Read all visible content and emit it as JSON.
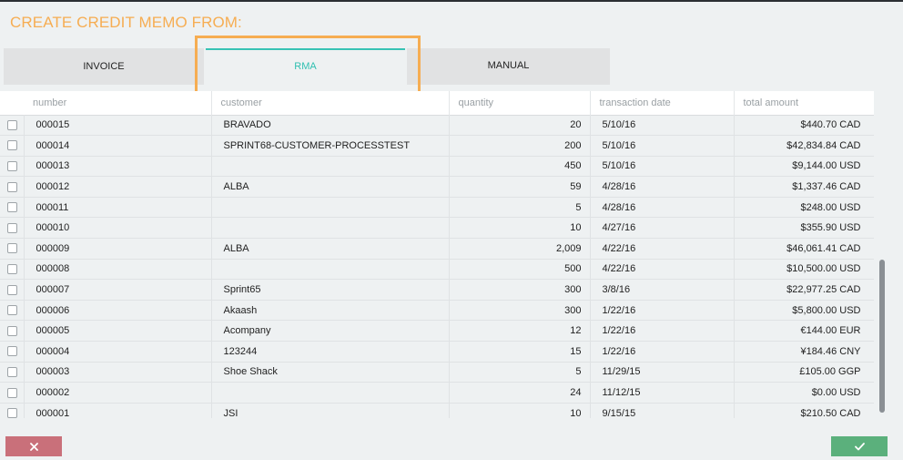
{
  "title": "CREATE CREDIT MEMO FROM:",
  "tabs": {
    "invoice": "INVOICE",
    "rma": "RMA",
    "manual": "MANUAL"
  },
  "table": {
    "headers": {
      "number": "number",
      "customer": "customer",
      "quantity": "quantity",
      "transaction_date": "transaction date",
      "total_amount": "total amount"
    },
    "rows": [
      {
        "number": "000015",
        "customer": "BRAVADO",
        "quantity": "20",
        "date": "5/10/16",
        "amount": "$440.70 CAD"
      },
      {
        "number": "000014",
        "customer": "SPRINT68-CUSTOMER-PROCESSTEST",
        "quantity": "200",
        "date": "5/10/16",
        "amount": "$42,834.84 CAD"
      },
      {
        "number": "000013",
        "customer": "",
        "quantity": "450",
        "date": "5/10/16",
        "amount": "$9,144.00 USD"
      },
      {
        "number": "000012",
        "customer": "ALBA",
        "quantity": "59",
        "date": "4/28/16",
        "amount": "$1,337.46 CAD"
      },
      {
        "number": "000011",
        "customer": "",
        "quantity": "5",
        "date": "4/28/16",
        "amount": "$248.00 USD"
      },
      {
        "number": "000010",
        "customer": "",
        "quantity": "10",
        "date": "4/27/16",
        "amount": "$355.90 USD"
      },
      {
        "number": "000009",
        "customer": "ALBA",
        "quantity": "2,009",
        "date": "4/22/16",
        "amount": "$46,061.41 CAD"
      },
      {
        "number": "000008",
        "customer": "",
        "quantity": "500",
        "date": "4/22/16",
        "amount": "$10,500.00 USD"
      },
      {
        "number": "000007",
        "customer": "Sprint65",
        "quantity": "300",
        "date": "3/8/16",
        "amount": "$22,977.25 CAD"
      },
      {
        "number": "000006",
        "customer": "Akaash",
        "quantity": "300",
        "date": "1/22/16",
        "amount": "$5,800.00 USD"
      },
      {
        "number": "000005",
        "customer": "Acompany",
        "quantity": "12",
        "date": "1/22/16",
        "amount": "€144.00 EUR"
      },
      {
        "number": "000004",
        "customer": "123244",
        "quantity": "15",
        "date": "1/22/16",
        "amount": "¥184.46 CNY"
      },
      {
        "number": "000003",
        "customer": "Shoe Shack",
        "quantity": "5",
        "date": "11/29/15",
        "amount": "£105.00 GGP"
      },
      {
        "number": "000002",
        "customer": "",
        "quantity": "24",
        "date": "11/12/15",
        "amount": "$0.00 USD"
      },
      {
        "number": "000001",
        "customer": "JSI",
        "quantity": "10",
        "date": "9/15/15",
        "amount": "$210.50 CAD"
      }
    ]
  },
  "buttons": {
    "cancel_icon": "close-icon",
    "confirm_icon": "check-icon"
  },
  "colors": {
    "title": "#f6ad52",
    "active_tab": "#2fbfb0",
    "cancel": "#c9707a",
    "confirm": "#5bb07c"
  }
}
